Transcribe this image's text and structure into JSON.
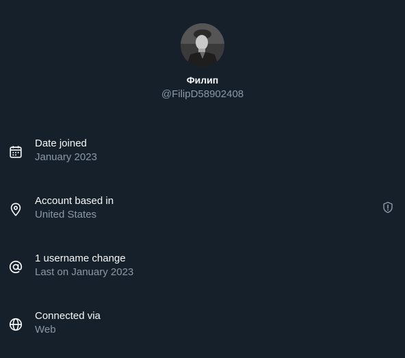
{
  "profile": {
    "display_name": "Филип",
    "handle": "@FilipD58902408",
    "avatar_icon": "profile-photo"
  },
  "details": [
    {
      "icon": "calendar-icon",
      "title": "Date joined",
      "value": "January 2023"
    },
    {
      "icon": "location-pin-icon",
      "title": "Account based in",
      "value": "United States",
      "badge_icon": "shield-exclamation-icon"
    },
    {
      "icon": "at-sign-icon",
      "title": "1 username change",
      "value": "Last on January 2023"
    },
    {
      "icon": "globe-icon",
      "title": "Connected via",
      "value": "Web"
    }
  ],
  "colors": {
    "background": "#15202b",
    "primary_text": "#f7f9f9",
    "secondary_text": "#8b98a5"
  }
}
